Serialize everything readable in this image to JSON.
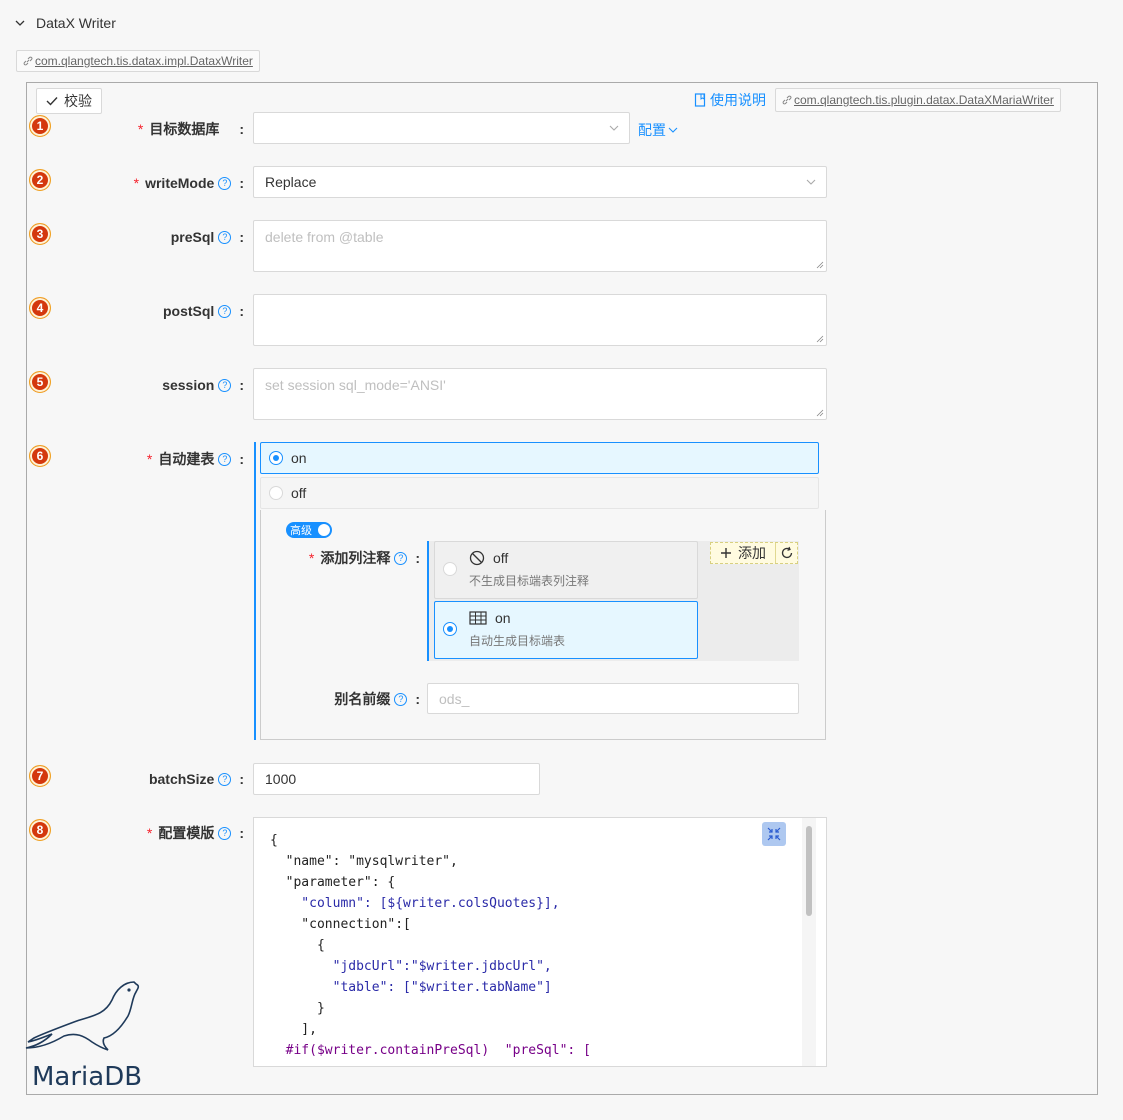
{
  "header": {
    "title": "DataX Writer",
    "impl_class": "com.qlangtech.tis.datax.impl.DataxWriter"
  },
  "toolbar": {
    "check_label": "校验",
    "help_label": "使用说明",
    "plugin_class": "com.qlangtech.tis.plugin.datax.DataXMariaWriter"
  },
  "fields": {
    "target_db": {
      "num": "1",
      "label": "目标数据库",
      "value": "",
      "config_label": "配置"
    },
    "write_mode": {
      "num": "2",
      "label": "writeMode",
      "value": "Replace"
    },
    "pre_sql": {
      "num": "3",
      "label": "preSql",
      "placeholder": "delete from @table"
    },
    "post_sql": {
      "num": "4",
      "label": "postSql",
      "placeholder": ""
    },
    "session": {
      "num": "5",
      "label": "session",
      "placeholder": "set session sql_mode='ANSI'"
    },
    "auto_create": {
      "num": "6",
      "label": "自动建表",
      "options": [
        {
          "label": "on",
          "selected": true
        },
        {
          "label": "off",
          "selected": false
        }
      ],
      "advanced_label": "高级",
      "add_comment": {
        "label": "添加列注释",
        "options": [
          {
            "title": "off",
            "desc": "不生成目标端表列注释",
            "icon": "ban-icon",
            "selected": false
          },
          {
            "title": "on",
            "desc": "自动生成目标端表",
            "icon": "table-icon",
            "selected": true
          }
        ],
        "add_label": "添加"
      },
      "alias_prefix": {
        "label": "别名前缀",
        "placeholder": "ods_"
      }
    },
    "batch_size": {
      "num": "7",
      "label": "batchSize",
      "value": "1000"
    },
    "template": {
      "num": "8",
      "label": "配置模版",
      "lines": [
        "{",
        "  \"name\": \"mysqlwriter\",",
        "  \"parameter\": {",
        "    \"column\": [${writer.colsQuotes}],",
        "    \"connection\":[",
        "      {",
        "        \"jdbcUrl\":\"$writer.jdbcUrl\",",
        "        \"table\": [\"$writer.tabName\"]",
        "      }",
        "    ],",
        "  #if($writer.containPreSql)  \"preSql\": ["
      ]
    }
  },
  "logo": {
    "text": "MariaDB"
  },
  "colors": {
    "accent": "#1890ff",
    "required": "#f5222d",
    "badge": "#d4380d"
  }
}
